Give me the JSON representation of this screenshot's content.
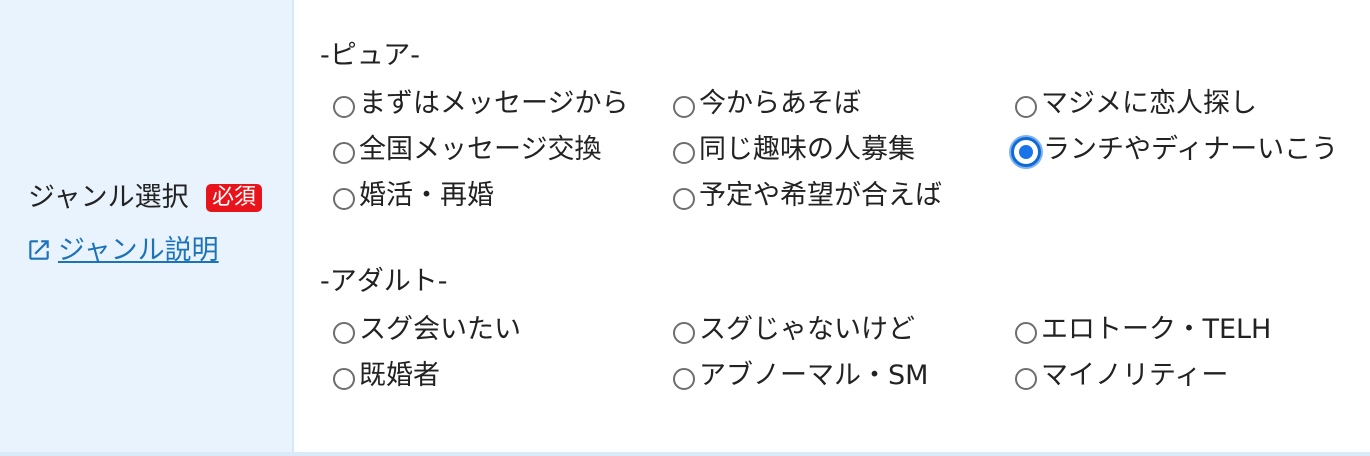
{
  "field": {
    "label": "ジャンル選択",
    "required_badge": "必須",
    "help_link": "ジャンル説明",
    "badge_color": "#e8141c",
    "link_color": "#1d73b8"
  },
  "sections": [
    {
      "heading": "-ピュア-",
      "options": [
        {
          "label": "まずはメッセージから",
          "checked": false
        },
        {
          "label": "今からあそぼ",
          "checked": false
        },
        {
          "label": "マジメに恋人探し",
          "checked": false
        },
        {
          "label": "全国メッセージ交換",
          "checked": false
        },
        {
          "label": "同じ趣味の人募集",
          "checked": false
        },
        {
          "label": "ランチやディナーいこう",
          "checked": true
        },
        {
          "label": "婚活・再婚",
          "checked": false
        },
        {
          "label": "予定や希望が合えば",
          "checked": false
        }
      ]
    },
    {
      "heading": "-アダルト-",
      "options": [
        {
          "label": "スグ会いたい",
          "checked": false
        },
        {
          "label": "スグじゃないけど",
          "checked": false
        },
        {
          "label": "エロトーク・TELH",
          "checked": false
        },
        {
          "label": "既婚者",
          "checked": false
        },
        {
          "label": "アブノーマル・SM",
          "checked": false
        },
        {
          "label": "マイノリティー",
          "checked": false
        }
      ]
    }
  ],
  "icons": {
    "help_link_icon": "external-link-icon"
  },
  "colors": {
    "label_cell_bg": "#e9f3fd",
    "radio_selected": "#1a73e8"
  }
}
